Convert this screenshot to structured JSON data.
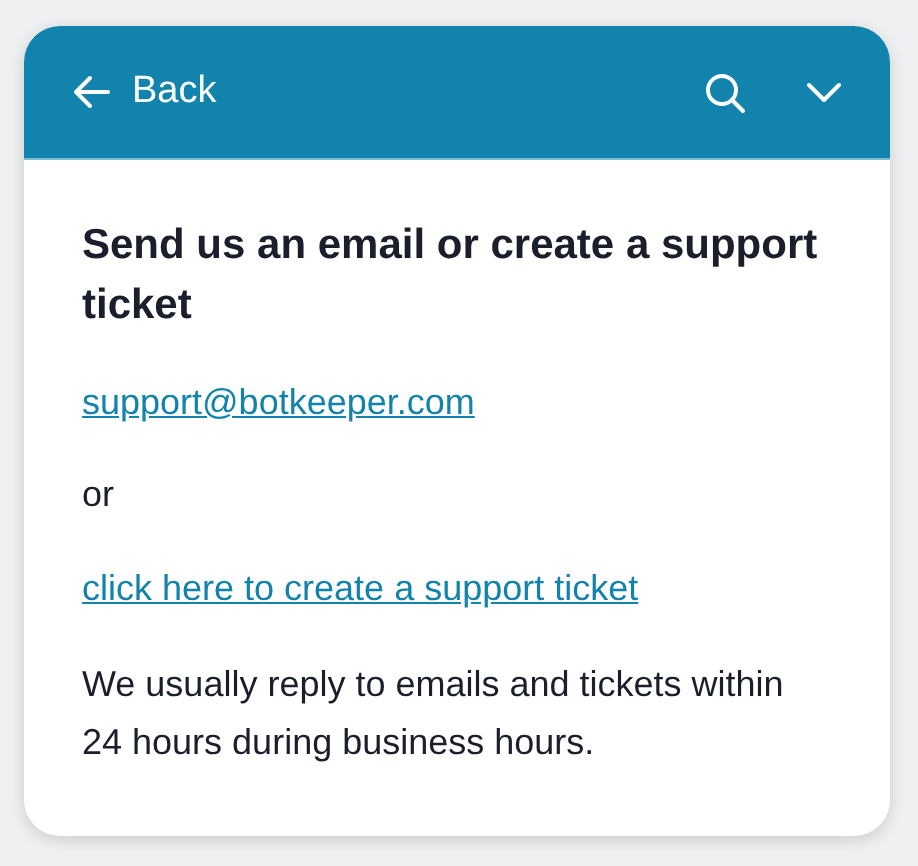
{
  "header": {
    "back_label": "Back"
  },
  "content": {
    "title": "Send us an email or create a support ticket",
    "email_link": "support@botkeeper.com",
    "separator": "or",
    "ticket_link": "click here to create a support ticket",
    "note": "We usually reply to emails and tickets within 24 hours during business hours."
  }
}
